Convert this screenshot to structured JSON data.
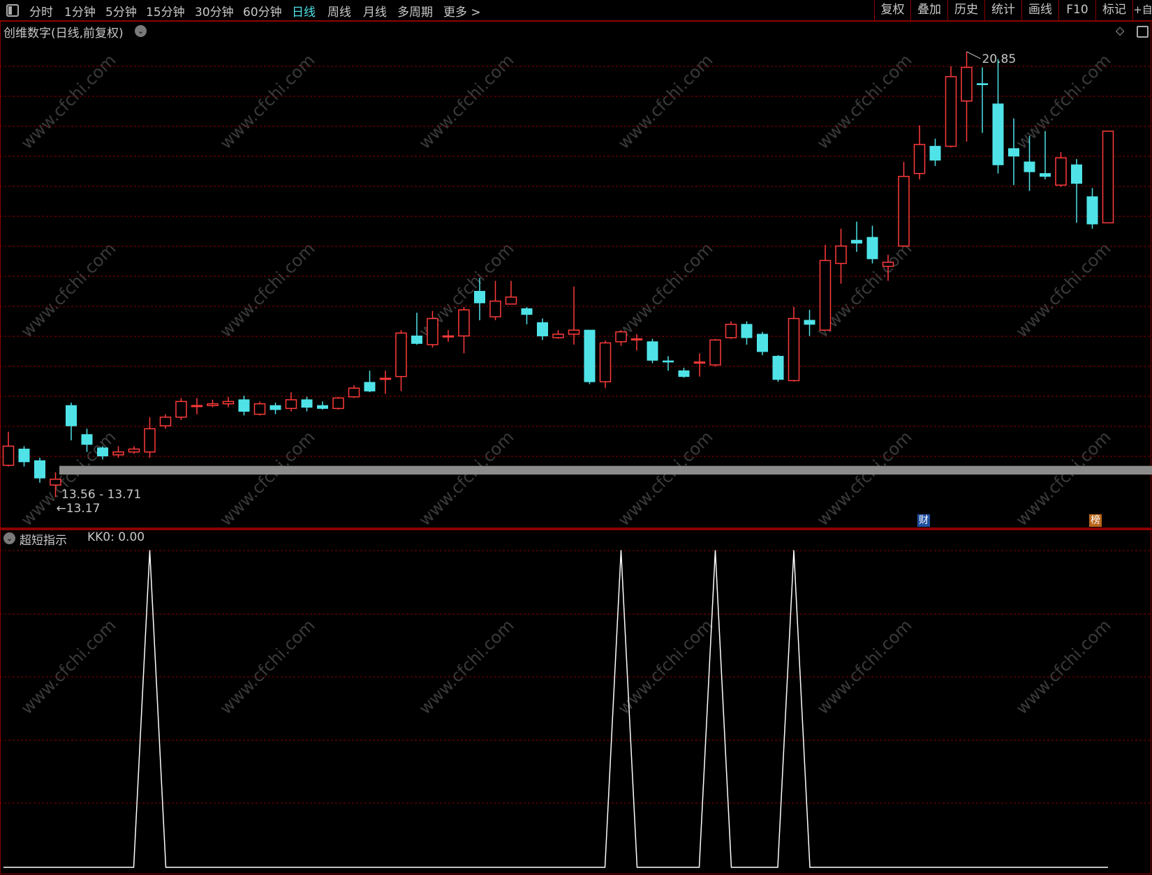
{
  "toolbar": {
    "periods": [
      "分时",
      "1分钟",
      "5分钟",
      "15分钟",
      "30分钟",
      "60分钟",
      "日线",
      "周线",
      "月线",
      "多周期",
      "更多 >"
    ],
    "active_period": "日线",
    "right_buttons": [
      "复权",
      "叠加",
      "历史",
      "统计",
      "画线",
      "F10",
      "标记",
      "+自"
    ]
  },
  "main_chart": {
    "title": "创维数字(日线,前复权)",
    "high_label": "20.85",
    "low_label": "13.17",
    "range_label": "13.56 - 13.71",
    "badge_cai": "财",
    "badge_bang": "榜"
  },
  "indicator": {
    "name": "超短指示",
    "value_label": "KK0: 0.00"
  },
  "watermark": "www.cfchi.com",
  "colors": {
    "up": "#ff3b3b",
    "down": "#4fe3e8",
    "grid": "#8b0000",
    "line": "#ffffff",
    "highlight_bar": "#8c8c8c"
  },
  "chart_data": [
    {
      "type": "candlestick",
      "title": "创维数字(日线,前复权)",
      "ylim": [
        12.9,
        21.2
      ],
      "candles": [
        {
          "o": 13.72,
          "c": 14.05,
          "h": 14.3,
          "l": 13.7
        },
        {
          "o": 14.0,
          "c": 13.78,
          "h": 14.05,
          "l": 13.7
        },
        {
          "o": 13.8,
          "c": 13.5,
          "h": 13.85,
          "l": 13.42
        },
        {
          "o": 13.38,
          "c": 13.48,
          "h": 13.6,
          "l": 13.17
        },
        {
          "o": 14.75,
          "c": 14.4,
          "h": 14.8,
          "l": 14.15
        },
        {
          "o": 14.25,
          "c": 14.08,
          "h": 14.35,
          "l": 13.95
        },
        {
          "o": 14.02,
          "c": 13.88,
          "h": 14.05,
          "l": 13.82
        },
        {
          "o": 13.9,
          "c": 13.95,
          "h": 14.05,
          "l": 13.85
        },
        {
          "o": 13.95,
          "c": 14.0,
          "h": 14.05,
          "l": 13.92
        },
        {
          "o": 13.95,
          "c": 14.35,
          "h": 14.55,
          "l": 13.85
        },
        {
          "o": 14.4,
          "c": 14.55,
          "h": 14.6,
          "l": 14.35
        },
        {
          "o": 14.55,
          "c": 14.82,
          "h": 14.88,
          "l": 14.5
        },
        {
          "o": 14.75,
          "c": 14.75,
          "h": 14.88,
          "l": 14.6
        },
        {
          "o": 14.75,
          "c": 14.78,
          "h": 14.85,
          "l": 14.72
        },
        {
          "o": 14.78,
          "c": 14.82,
          "h": 14.9,
          "l": 14.72
        },
        {
          "o": 14.85,
          "c": 14.65,
          "h": 14.92,
          "l": 14.58
        },
        {
          "o": 14.6,
          "c": 14.78,
          "h": 14.82,
          "l": 14.58
        },
        {
          "o": 14.75,
          "c": 14.68,
          "h": 14.8,
          "l": 14.6
        },
        {
          "o": 14.7,
          "c": 14.85,
          "h": 14.98,
          "l": 14.65
        },
        {
          "o": 14.85,
          "c": 14.72,
          "h": 14.9,
          "l": 14.65
        },
        {
          "o": 14.75,
          "c": 14.7,
          "h": 14.82,
          "l": 14.68
        },
        {
          "o": 14.7,
          "c": 14.88,
          "h": 14.9,
          "l": 14.68
        },
        {
          "o": 14.9,
          "c": 15.05,
          "h": 15.1,
          "l": 14.88
        },
        {
          "o": 15.15,
          "c": 15.0,
          "h": 15.35,
          "l": 14.98
        },
        {
          "o": 15.22,
          "c": 15.22,
          "h": 15.35,
          "l": 14.95
        },
        {
          "o": 15.25,
          "c": 16.0,
          "h": 16.05,
          "l": 15.0
        },
        {
          "o": 15.95,
          "c": 15.82,
          "h": 16.35,
          "l": 15.8
        },
        {
          "o": 15.8,
          "c": 16.25,
          "h": 16.38,
          "l": 15.75
        },
        {
          "o": 15.95,
          "c": 15.95,
          "h": 16.05,
          "l": 15.85
        },
        {
          "o": 15.95,
          "c": 16.4,
          "h": 16.45,
          "l": 15.65
        },
        {
          "o": 16.72,
          "c": 16.52,
          "h": 16.95,
          "l": 16.22
        },
        {
          "o": 16.28,
          "c": 16.55,
          "h": 16.9,
          "l": 16.22
        },
        {
          "o": 16.5,
          "c": 16.62,
          "h": 16.9,
          "l": 16.5
        },
        {
          "o": 16.42,
          "c": 16.32,
          "h": 16.45,
          "l": 16.15
        },
        {
          "o": 16.18,
          "c": 15.95,
          "h": 16.25,
          "l": 15.88
        },
        {
          "o": 15.92,
          "c": 15.98,
          "h": 16.05,
          "l": 15.9
        },
        {
          "o": 15.98,
          "c": 16.05,
          "h": 16.8,
          "l": 15.8
        },
        {
          "o": 16.05,
          "c": 15.16,
          "h": 16.05,
          "l": 15.12
        },
        {
          "o": 15.16,
          "c": 15.83,
          "h": 15.87,
          "l": 15.05
        },
        {
          "o": 15.85,
          "c": 16.02,
          "h": 16.05,
          "l": 15.78
        },
        {
          "o": 15.9,
          "c": 15.9,
          "h": 15.98,
          "l": 15.7
        },
        {
          "o": 15.85,
          "c": 15.53,
          "h": 15.9,
          "l": 15.48
        },
        {
          "o": 15.52,
          "c": 15.5,
          "h": 15.6,
          "l": 15.35
        },
        {
          "o": 15.35,
          "c": 15.25,
          "h": 15.4,
          "l": 15.23
        },
        {
          "o": 15.5,
          "c": 15.5,
          "h": 15.65,
          "l": 15.25
        },
        {
          "o": 15.45,
          "c": 15.88,
          "h": 15.9,
          "l": 15.42
        },
        {
          "o": 15.92,
          "c": 16.15,
          "h": 16.2,
          "l": 15.9
        },
        {
          "o": 16.15,
          "c": 15.92,
          "h": 16.2,
          "l": 15.8
        },
        {
          "o": 15.98,
          "c": 15.68,
          "h": 16.02,
          "l": 15.62
        },
        {
          "o": 15.6,
          "c": 15.2,
          "h": 15.62,
          "l": 15.16
        },
        {
          "o": 15.18,
          "c": 16.25,
          "h": 16.45,
          "l": 15.16
        },
        {
          "o": 16.22,
          "c": 16.15,
          "h": 16.4,
          "l": 15.95
        },
        {
          "o": 16.05,
          "c": 17.25,
          "h": 17.52,
          "l": 16.05
        },
        {
          "o": 17.2,
          "c": 17.5,
          "h": 17.8,
          "l": 16.85
        },
        {
          "o": 17.6,
          "c": 17.55,
          "h": 17.92,
          "l": 17.4
        },
        {
          "o": 17.65,
          "c": 17.28,
          "h": 17.85,
          "l": 17.2
        },
        {
          "o": 17.15,
          "c": 17.22,
          "h": 17.35,
          "l": 16.9
        },
        {
          "o": 17.5,
          "c": 18.7,
          "h": 18.95,
          "l": 17.5
        },
        {
          "o": 18.75,
          "c": 19.25,
          "h": 19.58,
          "l": 18.65
        },
        {
          "o": 19.22,
          "c": 18.98,
          "h": 19.35,
          "l": 18.88
        },
        {
          "o": 19.22,
          "c": 20.42,
          "h": 20.6,
          "l": 19.2
        },
        {
          "o": 20.0,
          "c": 20.58,
          "h": 20.85,
          "l": 19.3
        },
        {
          "o": 20.3,
          "c": 20.28,
          "h": 20.58,
          "l": 19.45
        },
        {
          "o": 19.95,
          "c": 18.9,
          "h": 20.72,
          "l": 18.75
        },
        {
          "o": 19.18,
          "c": 19.05,
          "h": 19.7,
          "l": 18.55
        },
        {
          "o": 18.95,
          "c": 18.78,
          "h": 19.4,
          "l": 18.45
        },
        {
          "o": 18.75,
          "c": 18.7,
          "h": 19.48,
          "l": 18.65
        },
        {
          "o": 18.55,
          "c": 19.02,
          "h": 19.12,
          "l": 18.52
        },
        {
          "o": 18.9,
          "c": 18.58,
          "h": 19.0,
          "l": 17.9
        },
        {
          "o": 18.35,
          "c": 17.88,
          "h": 18.5,
          "l": 17.8
        },
        {
          "o": 17.9,
          "c": 19.48,
          "h": 19.48,
          "l": 17.9
        }
      ]
    },
    {
      "type": "line",
      "title": "超短指示",
      "series": [
        {
          "name": "KK0"
        }
      ],
      "ylim": [
        0,
        1
      ],
      "peak_indices": [
        9,
        39,
        45,
        50
      ]
    }
  ]
}
